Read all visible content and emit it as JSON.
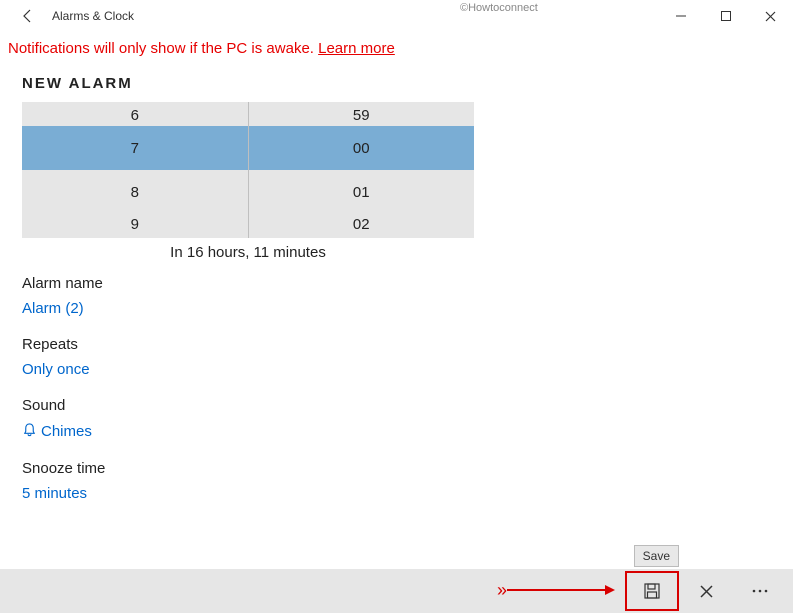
{
  "titlebar": {
    "app_title": "Alarms & Clock",
    "watermark": "©Howtoconnect"
  },
  "notification": {
    "text": "Notifications will only show if the PC is awake. ",
    "link": "Learn more"
  },
  "heading": "NEW ALARM",
  "picker": {
    "hour_prev": "6",
    "hour_selected": "7",
    "hour_next": "8",
    "hour_next2": "9",
    "min_prev": "59",
    "min_selected": "00",
    "min_next": "01",
    "min_next2": "02"
  },
  "time_remaining": "In 16 hours, 11 minutes",
  "fields": {
    "name_label": "Alarm name",
    "name_value": "Alarm (2)",
    "repeats_label": "Repeats",
    "repeats_value": "Only once",
    "sound_label": "Sound",
    "sound_value": "Chimes",
    "snooze_label": "Snooze time",
    "snooze_value": "5 minutes"
  },
  "tooltip": {
    "save": "Save"
  }
}
